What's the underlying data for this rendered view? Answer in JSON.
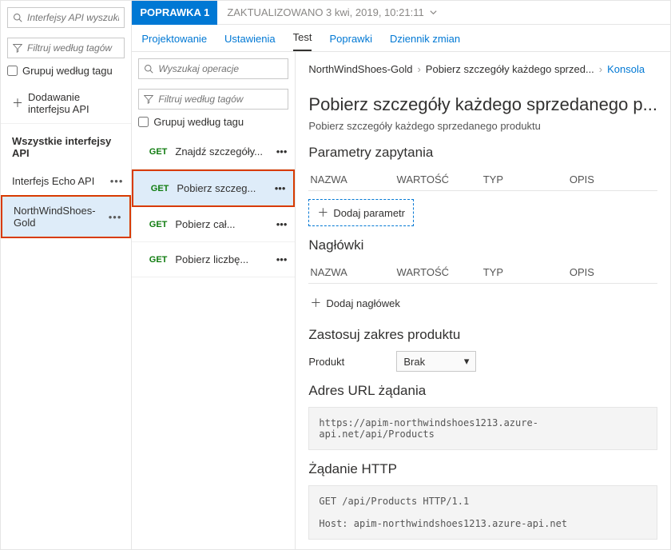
{
  "left": {
    "searchPlaceholder": "Interfejsy API wyszukiwania",
    "filterPlaceholder": "Filtruj według tagów",
    "groupLabel": "Grupuj według tagu",
    "addApi": "Dodawanie interfejsu API",
    "allApis": "Wszystkie interfejsy API",
    "apis": [
      {
        "name": "Interfejs Echo API",
        "selected": false,
        "boxed": false
      },
      {
        "name": "NorthWindShoes-Gold",
        "selected": true,
        "boxed": true
      }
    ]
  },
  "revision": {
    "badge": "POPRAWKA 1",
    "updated": "ZAKTUALIZOWANO 3 kwi, 2019, 10:21:11"
  },
  "tabs": [
    "Projektowanie",
    "Ustawienia",
    "Test",
    "Poprawki",
    "Dziennik zmian"
  ],
  "activeTab": "Test",
  "mid": {
    "searchPlaceholder": "Wyszukaj operacje",
    "filterPlaceholder": "Filtruj według tagów",
    "groupLabel": "Grupuj według tagu",
    "ops": [
      {
        "method": "GET",
        "name": "Znajdź szczegóły...",
        "sel": false,
        "boxed": false
      },
      {
        "method": "GET",
        "name": "Pobierz szczeg...",
        "sel": true,
        "boxed": true
      },
      {
        "method": "GET",
        "name": "Pobierz cał...",
        "sel": false,
        "boxed": false
      },
      {
        "method": "GET",
        "name": "Pobierz liczbę...",
        "sel": false,
        "boxed": false
      }
    ]
  },
  "crumbs": {
    "a": "NorthWindShoes-Gold",
    "b": "Pobierz szczegóły każdego sprzed...",
    "c": "Konsola"
  },
  "right": {
    "title": "Pobierz szczegóły każdego sprzedanego p...",
    "desc": "Pobierz szczegóły każdego sprzedanego produktu",
    "queryParamsHeading": "Parametry zapytania",
    "cols": {
      "name": "NAZWA",
      "value": "WARTOŚĆ",
      "type": "TYP",
      "desc": "OPIS"
    },
    "addParam": "Dodaj parametr",
    "headersHeading": "Nagłówki",
    "addHeader": "Dodaj nagłówek",
    "scopeHeading": "Zastosuj zakres produktu",
    "productLabel": "Produkt",
    "productValue": "Brak",
    "urlHeading": "Adres URL żądania",
    "url": "https://apim-northwindshoes1213.azure-api.net/api/Products",
    "httpHeading": "Żądanie HTTP",
    "http": "GET /api/Products HTTP/1.1\n\nHost: apim-northwindshoes1213.azure-api.net"
  }
}
